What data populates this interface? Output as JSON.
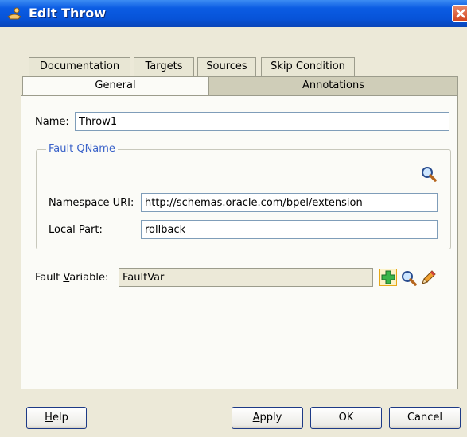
{
  "window": {
    "title": "Edit Throw"
  },
  "tabs": {
    "row1": [
      "Documentation",
      "Targets",
      "Sources",
      "Skip Condition"
    ],
    "row2": [
      "General",
      "Annotations"
    ],
    "active": "General"
  },
  "name": {
    "label_prefix": "N",
    "label_rest": "ame:",
    "value": "Throw1"
  },
  "fault_qname": {
    "legend": "Fault QName",
    "namespace_label_prefix": "Namespace ",
    "namespace_label_u": "U",
    "namespace_label_rest": "RI:",
    "namespace_value": "http://schemas.oracle.com/bpel/extension",
    "local_label_prefix": "Local ",
    "local_label_u": "P",
    "local_label_rest": "art:",
    "local_value": "rollback"
  },
  "fault_variable": {
    "label_prefix": "Fault ",
    "label_u": "V",
    "label_rest": "ariable:",
    "value": "FaultVar"
  },
  "buttons": {
    "help_u": "H",
    "help_rest": "elp",
    "apply_u": "A",
    "apply_rest": "pply",
    "ok": "OK",
    "cancel": "Cancel"
  },
  "icons": [
    "window-icon",
    "close-icon",
    "search-icon",
    "add-icon",
    "browse-icon",
    "edit-icon"
  ],
  "colors": {
    "titlebar": "#0753d8",
    "background": "#ece9d8",
    "panel": "#fbfbf7",
    "group_legend": "#3a62c9",
    "close": "#d2431c"
  }
}
